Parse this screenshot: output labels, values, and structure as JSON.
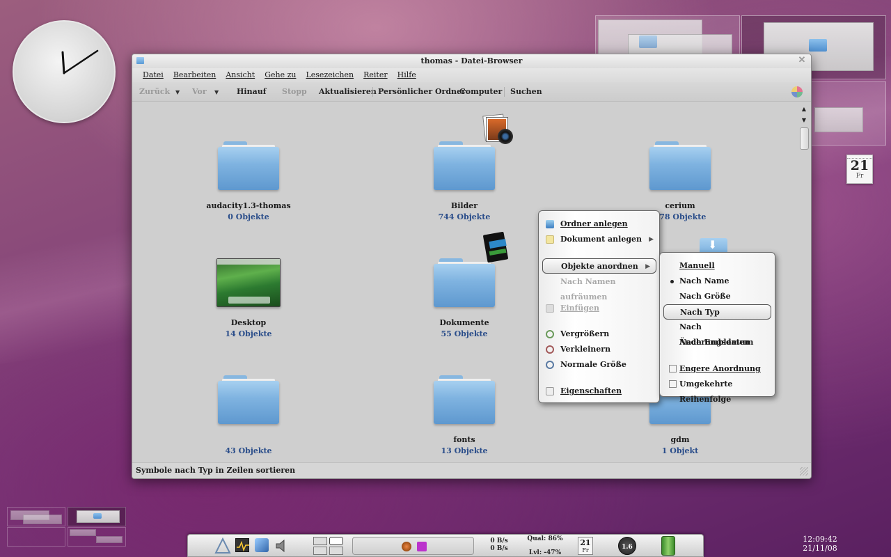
{
  "window": {
    "title": "thomas - Datei-Browser"
  },
  "menubar": [
    "Datei",
    "Bearbeiten",
    "Ansicht",
    "Gehe zu",
    "Lesezeichen",
    "Reiter",
    "Hilfe"
  ],
  "toolbar": {
    "back": "Zurück",
    "forward": "Vor",
    "up": "Hinauf",
    "stop": "Stopp",
    "reload": "Aktualisieren",
    "home": "Persönlicher Ordner",
    "computer": "Computer",
    "search": "Suchen"
  },
  "items": [
    {
      "name": "audacity1.3-thomas",
      "count": "0 Objekte"
    },
    {
      "name": "Bilder",
      "count": "744 Objekte"
    },
    {
      "name": "cerium",
      "count": "278 Objekte"
    },
    {
      "name": "Desktop",
      "count": "14 Objekte"
    },
    {
      "name": "Dokumente",
      "count": "55 Objekte"
    },
    {
      "name": "",
      "count": "43 Objekte"
    },
    {
      "name": "fonts",
      "count": "13 Objekte"
    },
    {
      "name": "gdm",
      "count": "1 Objekt"
    }
  ],
  "context_menu": {
    "new_folder": "Ordner anlegen",
    "new_document": "Dokument anlegen",
    "arrange": "Objekte anordnen",
    "clean_up": "Nach Namen aufräumen",
    "paste": "Einfügen",
    "zoom_in": "Vergrößern",
    "zoom_out": "Verkleinern",
    "normal_size": "Normale Größe",
    "properties": "Eigenschaften"
  },
  "arrange_menu": {
    "manual": "Manuell",
    "by_name": "Nach Name",
    "by_size": "Nach Größe",
    "by_type": "Nach Typ",
    "by_date": "Nach Änderungsdatum",
    "by_emblems": "Nach Emblemen",
    "compact": "Engere Anordnung",
    "reverse": "Umgekehrte Reihenfolge"
  },
  "statusbar": "Symbole nach Typ in Zeilen sortieren",
  "calendar": {
    "day": "21",
    "weekday": "Fr"
  },
  "taskbar": {
    "net_up": "0 B/s",
    "net_down": "0 B/s",
    "wifi_top": "Qual: 86%",
    "wifi_bottom": "Lvl: -47%",
    "cal_day": "21",
    "cal_wd": "Fr",
    "load": "1.6"
  },
  "clock": {
    "time": "12:09:42",
    "date": "21/11/08"
  }
}
